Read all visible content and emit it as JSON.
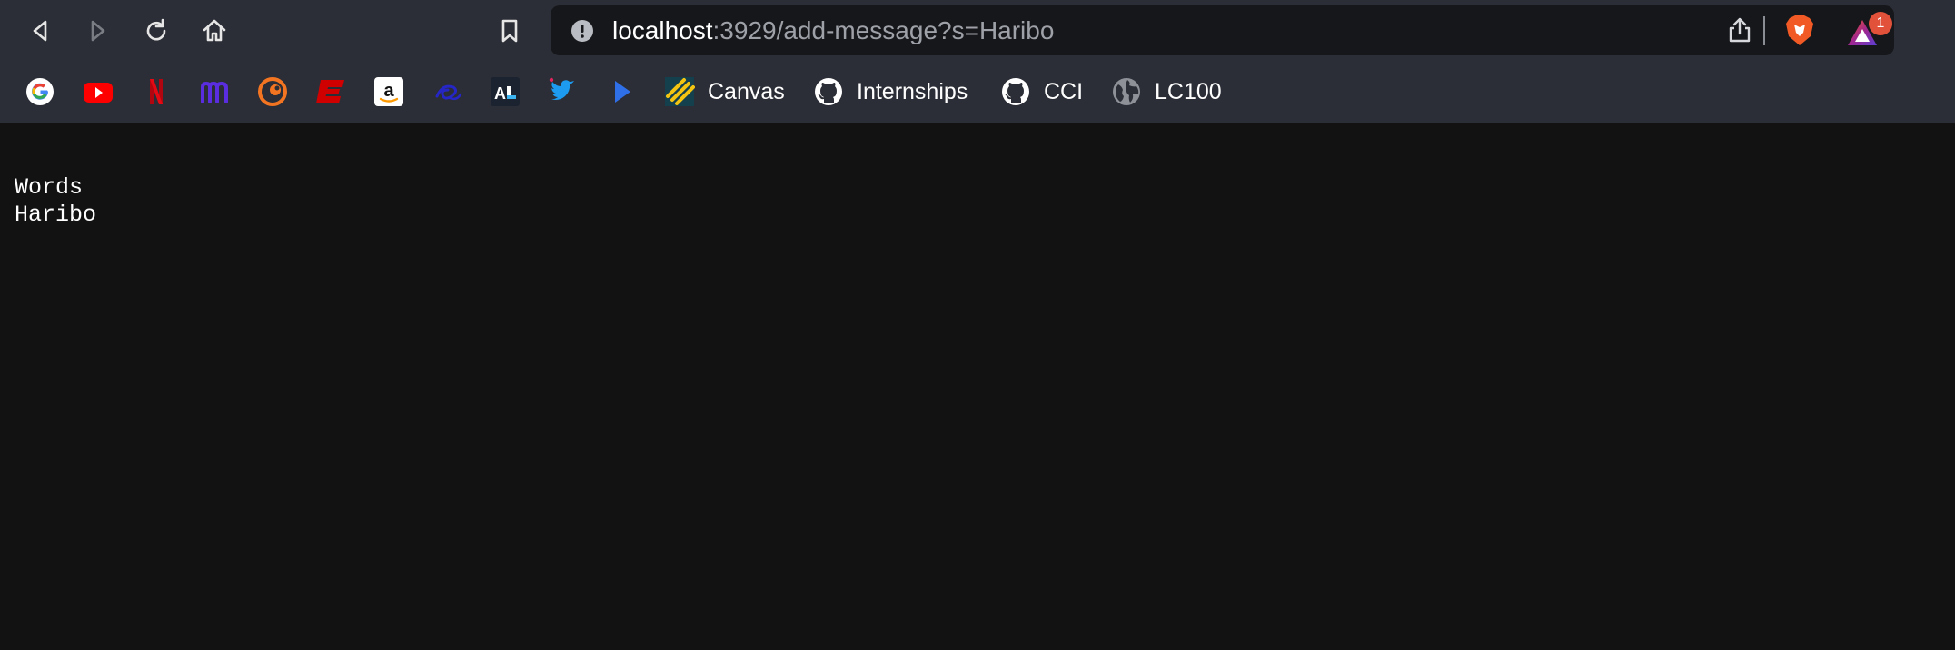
{
  "browser": {
    "address_bar": {
      "host": "localhost",
      "rest": ":3929/add-message?s=Haribo"
    },
    "rewards_badge": "1",
    "nav_icons": [
      "back-icon",
      "forward-icon",
      "reload-icon",
      "home-icon",
      "bookmark-icon"
    ]
  },
  "bookmarks": [
    {
      "label": "",
      "icon": "google-icon"
    },
    {
      "label": "",
      "icon": "youtube-icon"
    },
    {
      "label": "",
      "icon": "netflix-icon"
    },
    {
      "label": "",
      "icon": "m-icon"
    },
    {
      "label": "",
      "icon": "crunchyroll-icon"
    },
    {
      "label": "",
      "icon": "espn-icon"
    },
    {
      "label": "",
      "icon": "amazon-icon"
    },
    {
      "label": "",
      "icon": "swirl-icon"
    },
    {
      "label": "",
      "icon": "al-icon"
    },
    {
      "label": "",
      "icon": "twitter-icon"
    },
    {
      "label": "",
      "icon": "play-icon"
    },
    {
      "label": "Canvas",
      "icon": "canvas-icon"
    },
    {
      "label": "Internships",
      "icon": "github-icon"
    },
    {
      "label": "CCI",
      "icon": "github-icon"
    },
    {
      "label": "LC100",
      "icon": "globe-icon"
    }
  ],
  "page": {
    "lines": [
      "Words",
      "Haribo"
    ]
  },
  "colors": {
    "chrome": "#2b2e36",
    "url_bg": "#16171b",
    "page_bg": "#121212",
    "text": "#ffffff"
  }
}
